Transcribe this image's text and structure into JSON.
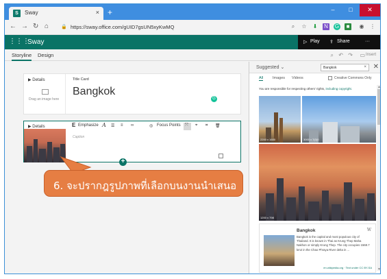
{
  "browser": {
    "tab_title": "Sway",
    "tab_close": "×",
    "new_tab": "+",
    "url": "https://sway.office.com/gUID7gsUN5xyKwMQ",
    "win_min": "–",
    "win_max": "□",
    "win_close": "✕"
  },
  "appbar": {
    "brand": "Sway",
    "play_label": "Play",
    "share_label": "Share",
    "more_label": "···"
  },
  "subnav": {
    "tabs": [
      {
        "label": "Storyline"
      },
      {
        "label": "Design"
      }
    ],
    "insert_label": "Insert"
  },
  "cards": {
    "title_card": {
      "details": "Details",
      "drag_text": "Drag an image here",
      "label": "Title Card",
      "title": "Bangkok"
    },
    "image_card": {
      "details": "Details",
      "emphasize": "Emphasize",
      "focus_points": "Focus Points",
      "caption": "Caption"
    }
  },
  "callout": {
    "text": "6. จะปรากฎรูปภาพที่เลือกบนงานนำเสนอ"
  },
  "panel": {
    "suggested": "Suggested",
    "search_value": "Bangkok",
    "filters": [
      "All",
      "Images",
      "Videos"
    ],
    "cc_label": "Creative Commons Only",
    "notice": "You are responsible for respecting others' rights, ",
    "notice_link": "including copyright.",
    "thumbs": [
      {
        "size": "2200 x 1600"
      },
      {
        "size": "3000 x 7(0)0"
      },
      {
        "size": "1200 x 798"
      }
    ],
    "wiki": {
      "title": "Bangkok",
      "desc": "Bangkok is the capital and most populous city of Thailand. It is known in Thai as Krung Thep Maha Nakhon or simply Krung Thep. The city occupies 1568.7 km2 in the Chao Phraya River delta in ...",
      "source": "en.wikipedia.org · Text under CC BY-SA"
    }
  },
  "colors": {
    "sway_green": "#0a7366",
    "callout_orange": "#e67e43",
    "browser_blue": "#3f8ee0"
  }
}
